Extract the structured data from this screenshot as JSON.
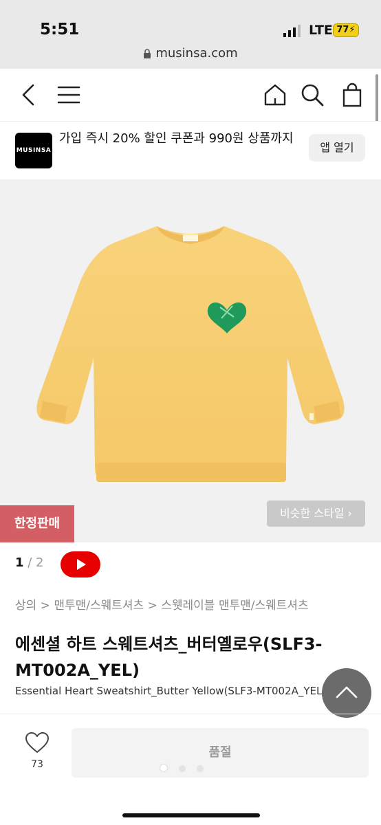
{
  "status_bar": {
    "time": "5:51",
    "network": "LTE",
    "battery": "77"
  },
  "browser": {
    "url": "musinsa.com"
  },
  "app_banner": {
    "logo_text": "MUSINSA",
    "message": "가입 즉시 20% 할인 쿠폰과 990원 상품까지",
    "open_app_label": "앱 열기"
  },
  "product_image": {
    "limited_label": "한정판매",
    "similar_style_label": "비슷한 스타일 ›"
  },
  "pager": {
    "current": "1",
    "separator": " / ",
    "total": "2"
  },
  "breadcrumb": "상의 > 맨투맨/스웨트셔츠 > 스웻레이블 맨투맨/스웨트셔츠",
  "product": {
    "title": "에센셜 하트 스웨트셔츠_버터옐로우(SLF3-MT002A_YEL)",
    "subtitle": "Essential Heart Sweatshirt_Butter Yellow(SLF3-MT002A_YEL)"
  },
  "bottom_bar": {
    "like_count": "73",
    "soldout_label": "품절"
  },
  "colors": {
    "accent": "#d35e64",
    "youtube": "#e60000",
    "sweatshirt": "#f7cd72",
    "heart": "#1f9a5a"
  }
}
